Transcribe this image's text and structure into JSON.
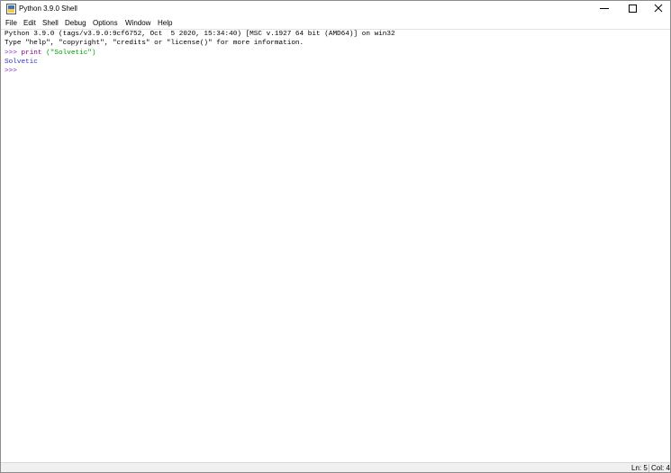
{
  "window": {
    "title": "Python 3.9.0 Shell"
  },
  "menu": {
    "items": [
      "File",
      "Edit",
      "Shell",
      "Debug",
      "Options",
      "Window",
      "Help"
    ]
  },
  "shell": {
    "banner_line1": "Python 3.9.0 (tags/v3.9.0:9cf6752, Oct  5 2020, 15:34:40) [MSC v.1927 64 bit (AMD64)] on win32",
    "banner_line2": "Type \"help\", \"copyright\", \"credits\" or \"license()\" for more information.",
    "prompt": ">>>",
    "cmd_keyword": "print",
    "cmd_string": "(\"Solvetic\")",
    "output": "Solvetic"
  },
  "status": {
    "line": "Ln: 5",
    "column": "Col: 4"
  },
  "colors": {
    "prompt": "#8a2be2",
    "keyword": "#800080",
    "string": "#00a000",
    "stdout": "#3333cc"
  },
  "icons": {
    "app": "python-idle-icon",
    "minimize": "minimize-icon",
    "maximize": "maximize-icon",
    "close": "close-icon"
  }
}
